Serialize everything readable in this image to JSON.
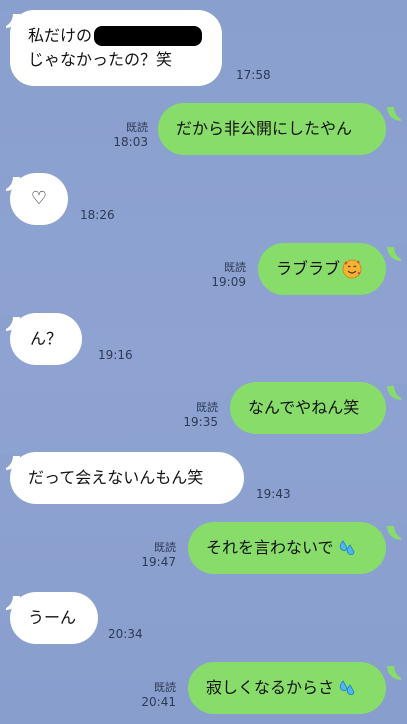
{
  "messages": [
    {
      "side": "in",
      "lines": [
        "私だけの",
        "じゃなかったの？笑"
      ],
      "time": "17:58"
    },
    {
      "side": "out",
      "text": "だから非公開にしたやん",
      "read": "既読",
      "time": "18:03"
    },
    {
      "side": "in",
      "text": "♡",
      "time": "18:26"
    },
    {
      "side": "out",
      "text": "ラブラブ",
      "read": "既読",
      "time": "19:09",
      "emoji": "smiling-face-with-hearts-icon"
    },
    {
      "side": "in",
      "text": "ん？",
      "time": "19:16"
    },
    {
      "side": "out",
      "text": "なんでやねん笑",
      "read": "既読",
      "time": "19:35"
    },
    {
      "side": "in",
      "text": "だって会えないんもん笑",
      "time": "19:43"
    },
    {
      "side": "out",
      "text": "それを言わないで",
      "read": "既読",
      "time": "19:47",
      "emoji": "sweat-droplets-icon"
    },
    {
      "side": "in",
      "text": "うーん",
      "time": "20:34"
    },
    {
      "side": "out",
      "text": "寂しくなるからさ",
      "read": "既読",
      "time": "20:41",
      "emoji": "sweat-droplets-icon"
    }
  ],
  "colors": {
    "background": "#8aa0cf",
    "incoming_bubble": "#ffffff",
    "outgoing_bubble": "#88dd6a"
  }
}
